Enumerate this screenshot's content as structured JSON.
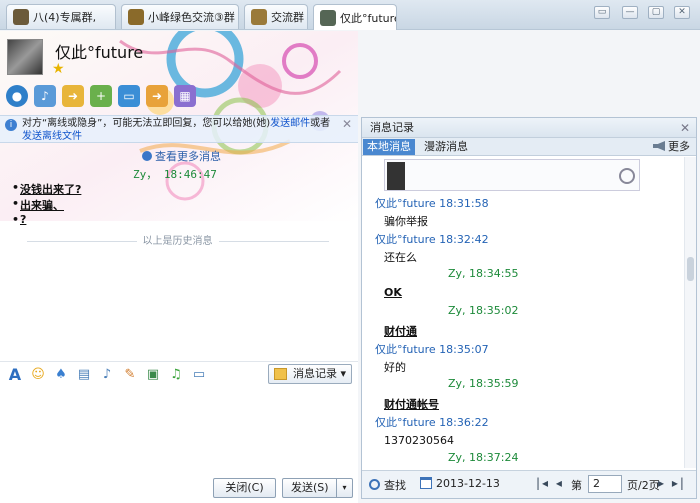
{
  "tabs": [
    {
      "label": "八(4)专属群,",
      "color": "#6b5a3a"
    },
    {
      "label": "小峰绿色交流③群",
      "color": "#8a6a2a"
    },
    {
      "label": "交流群",
      "color": "#9a7a3a"
    },
    {
      "label": "仅此°future",
      "color": "#556655"
    }
  ],
  "window_buttons": [
    "▭",
    "—",
    "▢",
    "✕"
  ],
  "chat": {
    "contact_name": "仅此°future",
    "notice": {
      "prefix": "对方“离线或隐身”，可能无法立即回复，您可以给她(她)",
      "link1": "发送邮件",
      "middle": "或者",
      "link2": "发送离线文件"
    },
    "more_history": "查看更多消息",
    "sender_line": "Zy，  18:46:47",
    "history_messages": [
      "没钱出来了?",
      "出来骗、",
      "?"
    ],
    "history_divider": "以上是历史消息",
    "history_button": "消息记录",
    "close_button": "关闭(C)",
    "send_button": "发送(S)"
  },
  "records": {
    "title": "消息记录",
    "tab_local": "本地消息",
    "tab_roam": "漫游消息",
    "more": "更多",
    "entries": [
      {
        "kind": "sender",
        "text": "仅此°future 18:31:58"
      },
      {
        "kind": "msg",
        "text": "骗你举报"
      },
      {
        "kind": "sender",
        "text": "仅此°future 18:32:42"
      },
      {
        "kind": "msg",
        "text": "还在么"
      },
      {
        "kind": "self",
        "text": "Zy, 18:34:55"
      },
      {
        "kind": "bold",
        "text": "OK"
      },
      {
        "kind": "self",
        "text": "Zy, 18:35:02"
      },
      {
        "kind": "bold",
        "text": "财付通"
      },
      {
        "kind": "sender",
        "text": "仅此°future 18:35:07"
      },
      {
        "kind": "msg",
        "text": "好的"
      },
      {
        "kind": "self",
        "text": "Zy, 18:35:59"
      },
      {
        "kind": "bold",
        "text": "财付通帐号"
      },
      {
        "kind": "sender",
        "text": "仅此°future 18:36:22"
      },
      {
        "kind": "msg",
        "text": "1370230564"
      },
      {
        "kind": "self",
        "text": "Zy, 18:37:24"
      }
    ],
    "footer": {
      "find": "查找",
      "date": "2013-12-13",
      "page_label": "第",
      "page": "2",
      "page_total": "页/2页"
    }
  }
}
